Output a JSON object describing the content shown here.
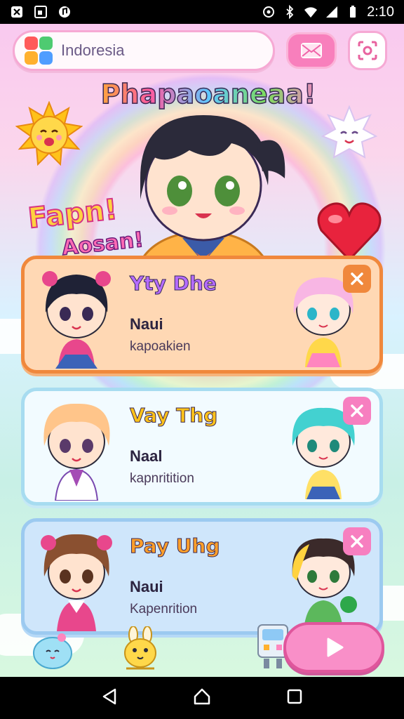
{
  "status_bar": {
    "time": "2:10",
    "left_icons": [
      "x-box-icon",
      "image-icon",
      "music-icon"
    ],
    "right_icons": [
      "vpn-icon",
      "bluetooth-icon",
      "wifi-icon",
      "signal-icon",
      "battery-icon"
    ]
  },
  "top_bar": {
    "region": "Indoresia"
  },
  "hero": {
    "title": "Phapaoaneaa!",
    "subtitle_1": "Fapn!",
    "subtitle_2": "Aosan!"
  },
  "cards": [
    {
      "title": "Yty Dhe",
      "name": "Naui",
      "role": "kapoakien"
    },
    {
      "title": "Vay Thg",
      "name": "Naal",
      "role": "kapnritition"
    },
    {
      "title": "Pay Uhg",
      "name": "Naui",
      "role": "Kapenrition"
    }
  ],
  "colors": {
    "accent_pink": "#f87fbc",
    "orange": "#f0883c",
    "sky": "#a7dcf0"
  }
}
